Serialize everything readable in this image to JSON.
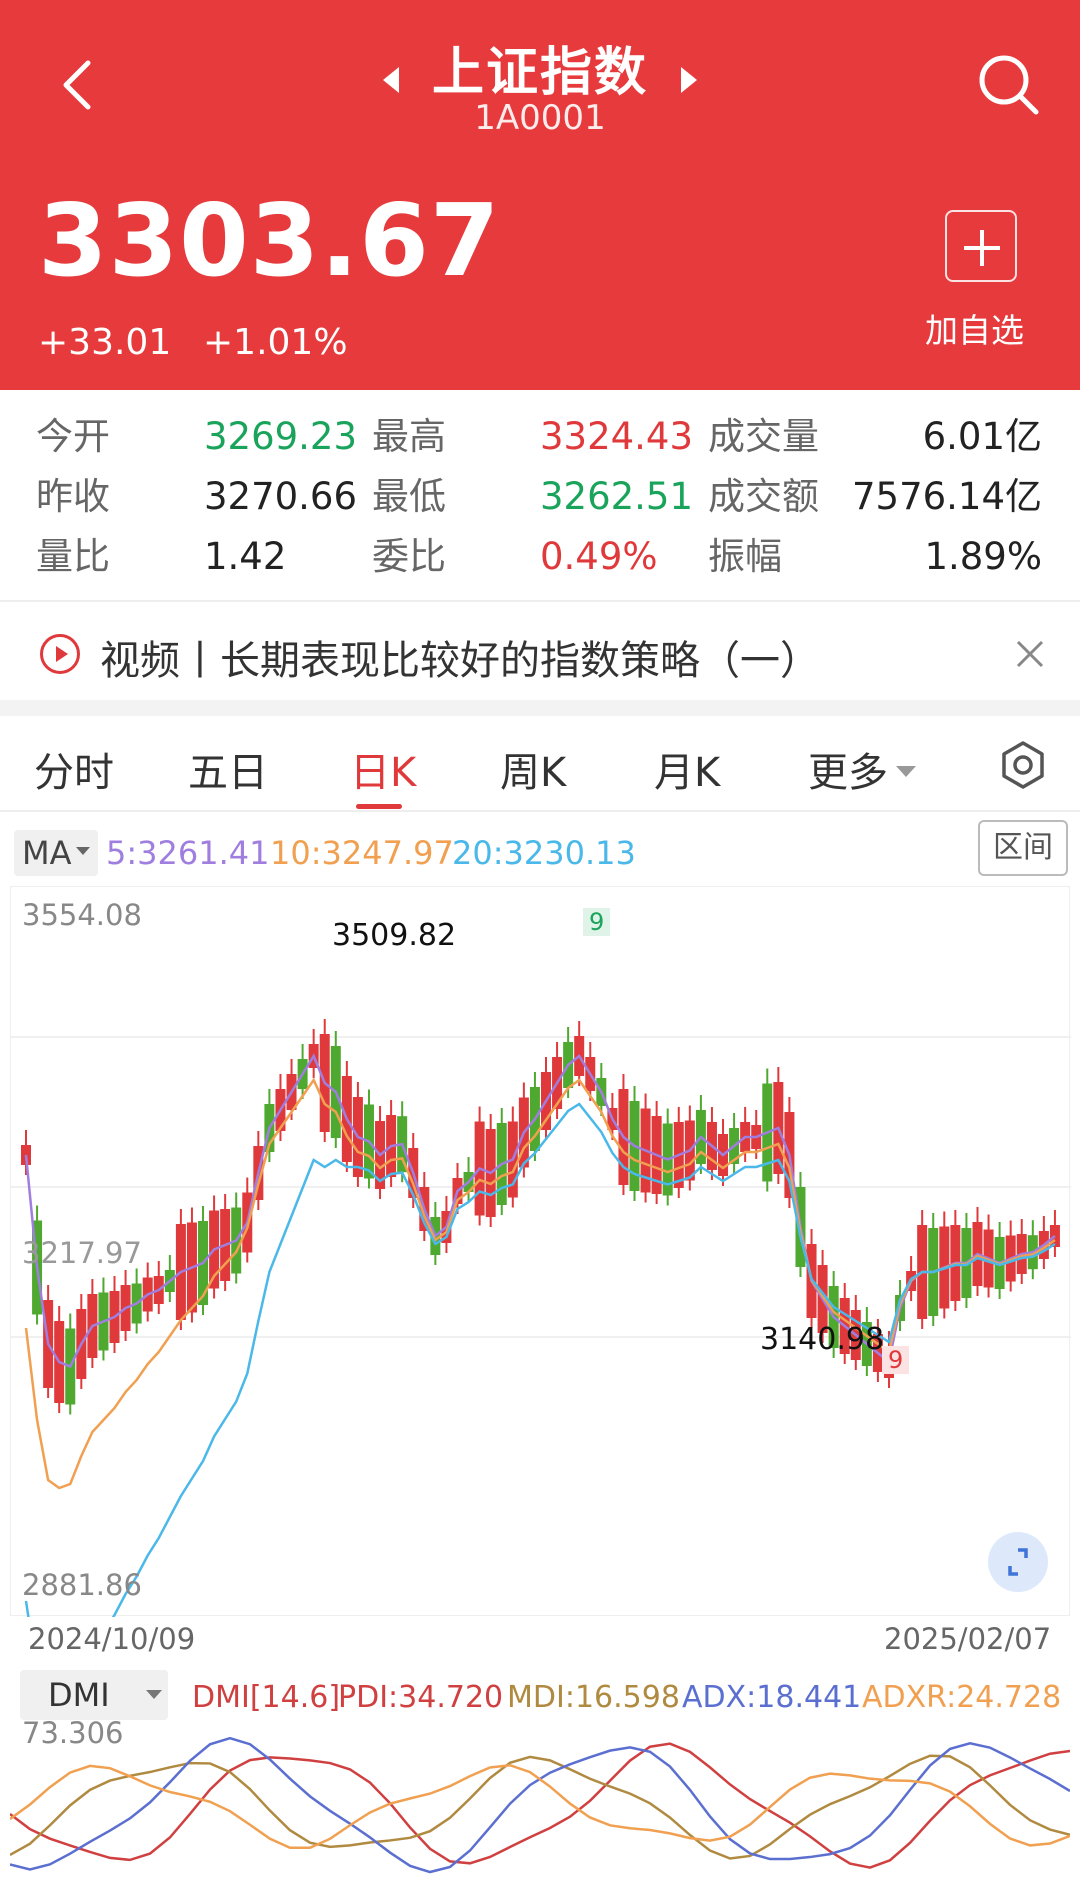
{
  "header": {
    "title": "上证指数",
    "code": "1A0001",
    "price": "3303.67",
    "change": "+33.01",
    "change_pct": "+1.01%",
    "add_label": "加自选",
    "bg_color": "#e63a3c"
  },
  "quote": [
    {
      "label": "今开",
      "value": "3269.23",
      "color": "green"
    },
    {
      "label": "最高",
      "value": "3324.43",
      "color": "red"
    },
    {
      "label": "成交量",
      "value": "6.01亿",
      "color": "dark"
    },
    {
      "label": "昨收",
      "value": "3270.66",
      "color": "dark"
    },
    {
      "label": "最低",
      "value": "3262.51",
      "color": "green"
    },
    {
      "label": "成交额",
      "value": "7576.14亿",
      "color": "dark"
    },
    {
      "label": "量比",
      "value": "1.42",
      "color": "dark"
    },
    {
      "label": "委比",
      "value": "0.49%",
      "color": "red"
    },
    {
      "label": "振幅",
      "value": "1.89%",
      "color": "dark"
    }
  ],
  "news": {
    "text": "视频丨长期表现比较好的指数策略（一）"
  },
  "tabs": [
    "分时",
    "五日",
    "日K",
    "周K",
    "月K",
    "更多"
  ],
  "active_tab": "日K",
  "ma": {
    "label": "MA",
    "ma5": "5:3261.41",
    "ma10": "10:3247.97",
    "ma20": "20:3230.13",
    "range_label": "区间",
    "colors": {
      "ma5": "#a07ee0",
      "ma10": "#f0a050",
      "ma20": "#4ab8e8"
    }
  },
  "chart": {
    "y_high": "3554.08",
    "y_low": "2881.86",
    "y_mid": "3217.97",
    "date_start": "2024/10/09",
    "date_end": "2025/02/07",
    "peak_label": "3509.82",
    "trough_label": "3140.98",
    "td_marker_top": "9",
    "td_marker_bottom": "9"
  },
  "dmi": {
    "label": "DMI",
    "params": "DMI[14.6]",
    "pdi": "PDI:34.720",
    "mdi": "MDI:16.598",
    "adx": "ADX:18.441",
    "adxr": "ADXR:24.728",
    "top_value": "73.306",
    "colors": {
      "pdi": "#d04040",
      "mdi": "#b08a40",
      "adx": "#5b6fd0",
      "adxr": "#f0a050"
    }
  }
}
